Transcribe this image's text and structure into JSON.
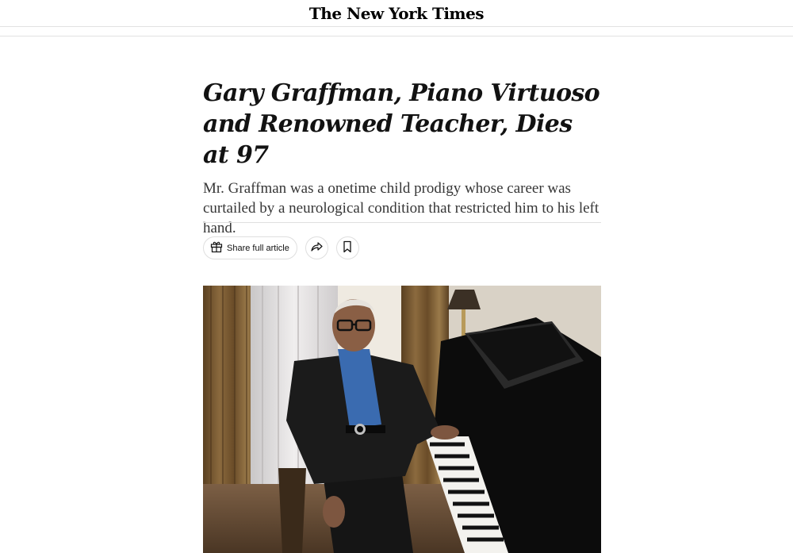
{
  "masthead": {
    "logo_text": "The New York Times"
  },
  "article": {
    "headline": "Gary Graffman, Piano Virtuoso and Renowned Teacher, Dies at 97",
    "summary": "Mr. Graffman was a onetime child prodigy whose career was curtailed by a neurological condition that restricted him to his left hand."
  },
  "toolbar": {
    "share_full_article_label": "Share full article",
    "icons": [
      "gift-icon",
      "share-arrow-icon",
      "bookmark-icon"
    ]
  },
  "photo": {
    "subject": "elderly man in glasses seated at a grand piano"
  },
  "colors": {
    "text": "#121212",
    "summary": "#363636",
    "border": "#dfdfdf"
  }
}
